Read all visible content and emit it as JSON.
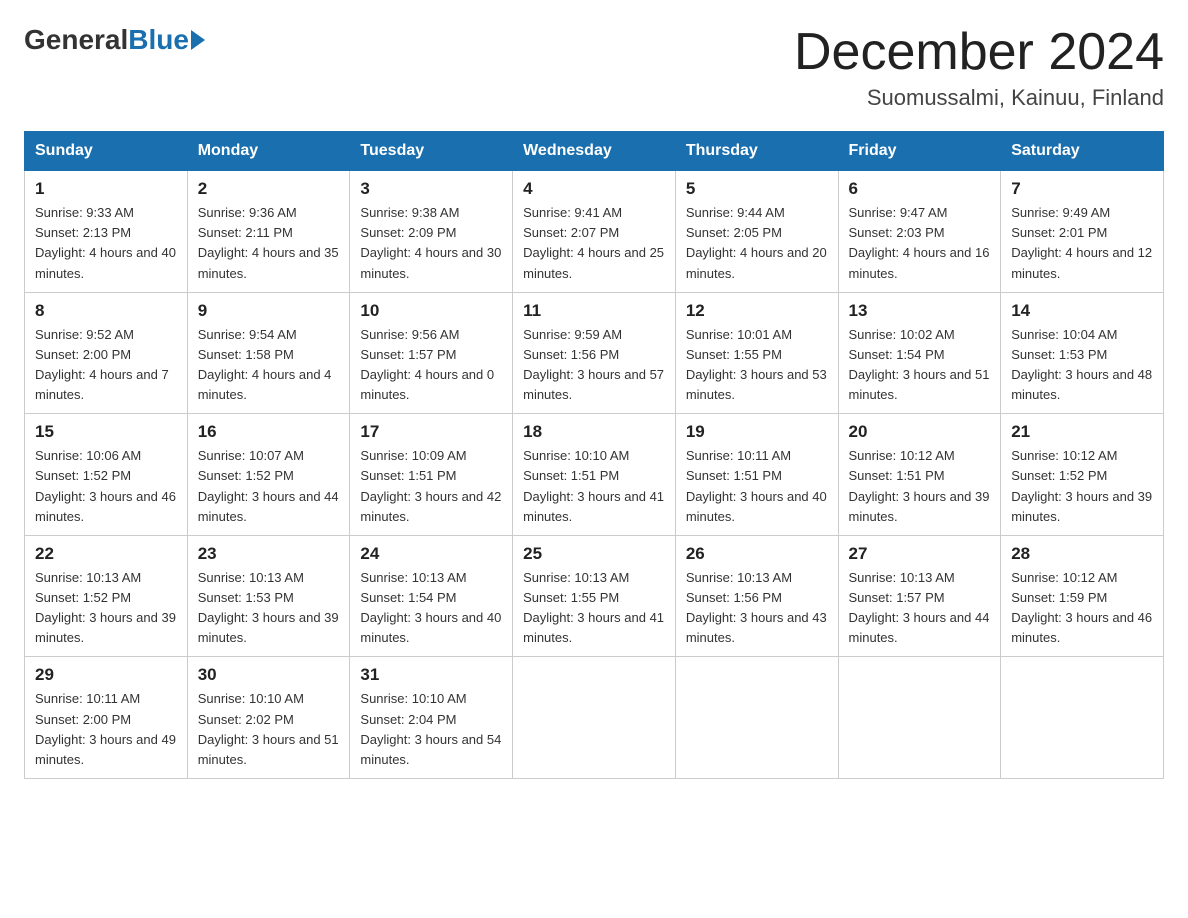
{
  "header": {
    "logo_general": "General",
    "logo_blue": "Blue",
    "month_title": "December 2024",
    "location": "Suomussalmi, Kainuu, Finland"
  },
  "weekdays": [
    "Sunday",
    "Monday",
    "Tuesday",
    "Wednesday",
    "Thursday",
    "Friday",
    "Saturday"
  ],
  "weeks": [
    [
      {
        "day": "1",
        "sunrise": "9:33 AM",
        "sunset": "2:13 PM",
        "daylight": "4 hours and 40 minutes."
      },
      {
        "day": "2",
        "sunrise": "9:36 AM",
        "sunset": "2:11 PM",
        "daylight": "4 hours and 35 minutes."
      },
      {
        "day": "3",
        "sunrise": "9:38 AM",
        "sunset": "2:09 PM",
        "daylight": "4 hours and 30 minutes."
      },
      {
        "day": "4",
        "sunrise": "9:41 AM",
        "sunset": "2:07 PM",
        "daylight": "4 hours and 25 minutes."
      },
      {
        "day": "5",
        "sunrise": "9:44 AM",
        "sunset": "2:05 PM",
        "daylight": "4 hours and 20 minutes."
      },
      {
        "day": "6",
        "sunrise": "9:47 AM",
        "sunset": "2:03 PM",
        "daylight": "4 hours and 16 minutes."
      },
      {
        "day": "7",
        "sunrise": "9:49 AM",
        "sunset": "2:01 PM",
        "daylight": "4 hours and 12 minutes."
      }
    ],
    [
      {
        "day": "8",
        "sunrise": "9:52 AM",
        "sunset": "2:00 PM",
        "daylight": "4 hours and 7 minutes."
      },
      {
        "day": "9",
        "sunrise": "9:54 AM",
        "sunset": "1:58 PM",
        "daylight": "4 hours and 4 minutes."
      },
      {
        "day": "10",
        "sunrise": "9:56 AM",
        "sunset": "1:57 PM",
        "daylight": "4 hours and 0 minutes."
      },
      {
        "day": "11",
        "sunrise": "9:59 AM",
        "sunset": "1:56 PM",
        "daylight": "3 hours and 57 minutes."
      },
      {
        "day": "12",
        "sunrise": "10:01 AM",
        "sunset": "1:55 PM",
        "daylight": "3 hours and 53 minutes."
      },
      {
        "day": "13",
        "sunrise": "10:02 AM",
        "sunset": "1:54 PM",
        "daylight": "3 hours and 51 minutes."
      },
      {
        "day": "14",
        "sunrise": "10:04 AM",
        "sunset": "1:53 PM",
        "daylight": "3 hours and 48 minutes."
      }
    ],
    [
      {
        "day": "15",
        "sunrise": "10:06 AM",
        "sunset": "1:52 PM",
        "daylight": "3 hours and 46 minutes."
      },
      {
        "day": "16",
        "sunrise": "10:07 AM",
        "sunset": "1:52 PM",
        "daylight": "3 hours and 44 minutes."
      },
      {
        "day": "17",
        "sunrise": "10:09 AM",
        "sunset": "1:51 PM",
        "daylight": "3 hours and 42 minutes."
      },
      {
        "day": "18",
        "sunrise": "10:10 AM",
        "sunset": "1:51 PM",
        "daylight": "3 hours and 41 minutes."
      },
      {
        "day": "19",
        "sunrise": "10:11 AM",
        "sunset": "1:51 PM",
        "daylight": "3 hours and 40 minutes."
      },
      {
        "day": "20",
        "sunrise": "10:12 AM",
        "sunset": "1:51 PM",
        "daylight": "3 hours and 39 minutes."
      },
      {
        "day": "21",
        "sunrise": "10:12 AM",
        "sunset": "1:52 PM",
        "daylight": "3 hours and 39 minutes."
      }
    ],
    [
      {
        "day": "22",
        "sunrise": "10:13 AM",
        "sunset": "1:52 PM",
        "daylight": "3 hours and 39 minutes."
      },
      {
        "day": "23",
        "sunrise": "10:13 AM",
        "sunset": "1:53 PM",
        "daylight": "3 hours and 39 minutes."
      },
      {
        "day": "24",
        "sunrise": "10:13 AM",
        "sunset": "1:54 PM",
        "daylight": "3 hours and 40 minutes."
      },
      {
        "day": "25",
        "sunrise": "10:13 AM",
        "sunset": "1:55 PM",
        "daylight": "3 hours and 41 minutes."
      },
      {
        "day": "26",
        "sunrise": "10:13 AM",
        "sunset": "1:56 PM",
        "daylight": "3 hours and 43 minutes."
      },
      {
        "day": "27",
        "sunrise": "10:13 AM",
        "sunset": "1:57 PM",
        "daylight": "3 hours and 44 minutes."
      },
      {
        "day": "28",
        "sunrise": "10:12 AM",
        "sunset": "1:59 PM",
        "daylight": "3 hours and 46 minutes."
      }
    ],
    [
      {
        "day": "29",
        "sunrise": "10:11 AM",
        "sunset": "2:00 PM",
        "daylight": "3 hours and 49 minutes."
      },
      {
        "day": "30",
        "sunrise": "10:10 AM",
        "sunset": "2:02 PM",
        "daylight": "3 hours and 51 minutes."
      },
      {
        "day": "31",
        "sunrise": "10:10 AM",
        "sunset": "2:04 PM",
        "daylight": "3 hours and 54 minutes."
      },
      null,
      null,
      null,
      null
    ]
  ]
}
